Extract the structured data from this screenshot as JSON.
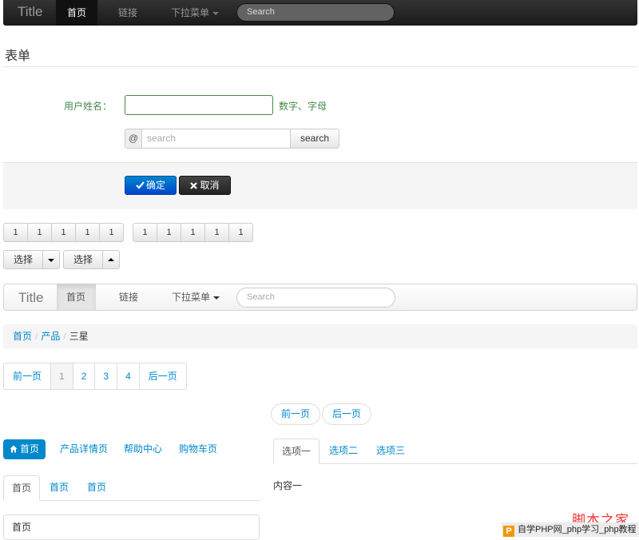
{
  "navbar_dark": {
    "brand": "Title",
    "items": [
      "首页",
      "链接",
      "下拉菜单"
    ],
    "search_placeholder": "Search"
  },
  "form": {
    "legend": "表单",
    "username_label": "用户姓名：",
    "username_help": "数字、字母",
    "addon_symbol": "@",
    "search_placeholder": "search",
    "search_button": "search",
    "confirm_button": "确定",
    "cancel_button": "取消"
  },
  "button_groups": {
    "group1": [
      "1",
      "1",
      "1",
      "1",
      "1"
    ],
    "group2": [
      "1",
      "1",
      "1",
      "1",
      "1"
    ],
    "split_down_label": "选择",
    "split_up_label": "选择"
  },
  "navbar_light": {
    "brand": "Title",
    "items": [
      "首页",
      "链接",
      "下拉菜单"
    ],
    "search_placeholder": "Search"
  },
  "breadcrumb": {
    "items": [
      "首页",
      "产品"
    ],
    "current": "三星"
  },
  "pagination": {
    "prev": "前一页",
    "pages": [
      "1",
      "2",
      "3",
      "4"
    ],
    "next": "后一页"
  },
  "pager": {
    "prev": "前一页",
    "next": "后一页"
  },
  "pills": [
    "首页",
    "产品详情页",
    "帮助中心",
    "购物车页"
  ],
  "tabs_left": [
    "首页",
    "首页",
    "首页"
  ],
  "well_text": "首页",
  "tabs_right": [
    "选项一",
    "选项二",
    "选项三"
  ],
  "tab_content": "内容一",
  "watermark": {
    "title": "脚本之家",
    "logo": "P",
    "bar_text": "自学PHP网_php学习_php教程"
  }
}
